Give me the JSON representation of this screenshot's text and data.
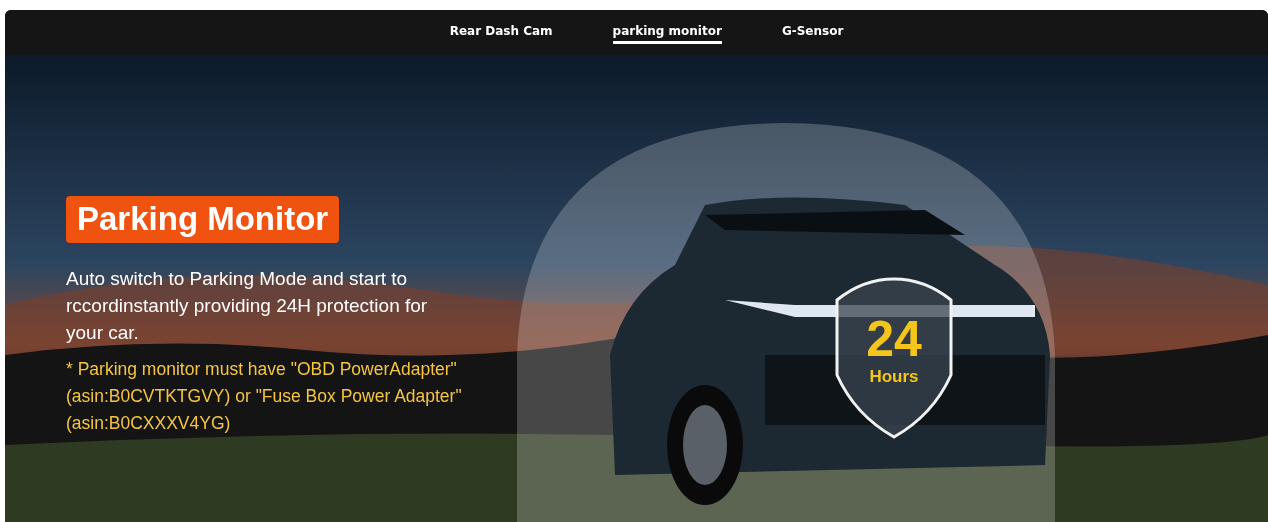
{
  "tabs": [
    {
      "label": "Rear Dash Cam",
      "selected": false
    },
    {
      "label": "parking monitor",
      "selected": true
    },
    {
      "label": "G-Sensor",
      "selected": false
    }
  ],
  "banner": {
    "kind": "picture",
    "title": "Parking Monitor",
    "description": "Auto switch to Parking Mode and start to rccordinstantly providing 24H protection for your car.",
    "note": "* Parking monitor must have \"OBD PowerAdapter\" (asin:B0CVTKTGVY) or \"Fuse Box Power Adapter\" (asin:B0CXXXV4YG)",
    "badge": {
      "number": "24",
      "unit": "Hours"
    }
  }
}
